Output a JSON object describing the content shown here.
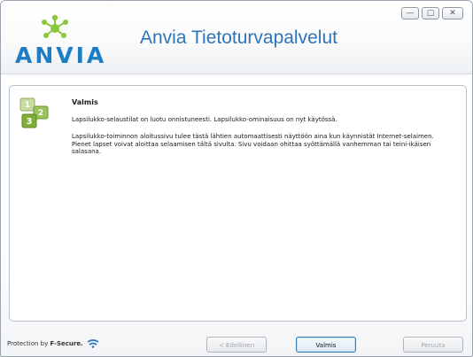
{
  "window": {
    "title": "Anvia Tietoturvapalvelut",
    "logo_text": "ANVIA",
    "controls": {
      "minimize": "—",
      "maximize": "▢",
      "close": "✕"
    }
  },
  "content": {
    "heading": "Valmis",
    "paragraph1": "Lapsilukko-selaustilat on luotu onnistuneesti. Lapsilukko-ominaisuus on nyt käytössä.",
    "paragraph2": "Lapsilukko-toiminnon aloitussivu tulee tästä lähtien automaattisesti näyttöön aina kun käynnistät Internet-selaimen. Pienet lapset voivat aloittaa selaamisen tältä sivulta. Sivu voidaan ohittaa syöttämällä vanhemman tai teini-ikäisen salasana."
  },
  "footer": {
    "protection_prefix": "Protection by",
    "brand": "F-Secure.",
    "buttons": {
      "previous": "< Edellinen",
      "finish": "Valmis",
      "cancel": "Peruuta"
    }
  },
  "colors": {
    "accent_blue": "#2d75b8",
    "logo_green": "#8cc63f",
    "logo_blue": "#1d7ec6"
  }
}
